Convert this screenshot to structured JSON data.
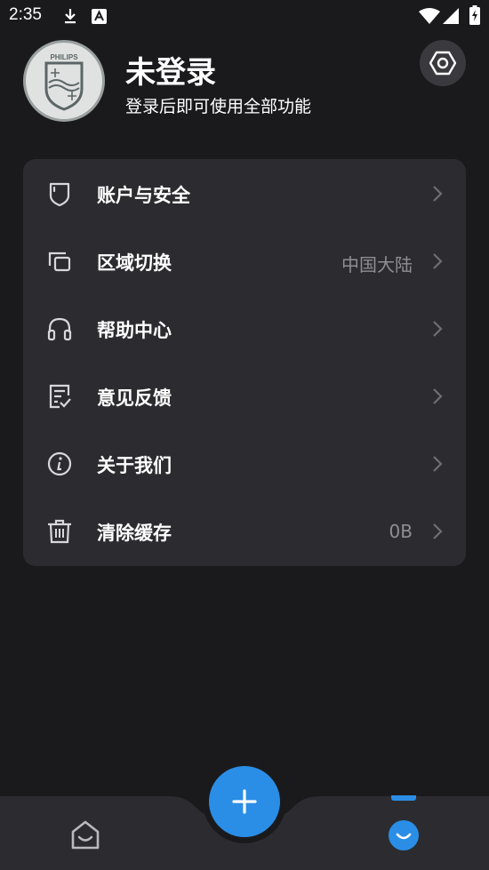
{
  "status_bar": {
    "time": "2:35",
    "icons": [
      "download-icon",
      "font-icon",
      "wifi-icon",
      "signal-icon",
      "battery-charging-icon"
    ]
  },
  "profile": {
    "title": "未登录",
    "subtitle": "登录后即可使用全部功能",
    "avatar_brand": "PHILIPS"
  },
  "menu": {
    "items": [
      {
        "label": "账户与安全",
        "value": "",
        "icon": "shield-icon"
      },
      {
        "label": "区域切换",
        "value": "中国大陆",
        "icon": "region-switch-icon"
      },
      {
        "label": "帮助中心",
        "value": "",
        "icon": "headphones-icon"
      },
      {
        "label": "意见反馈",
        "value": "",
        "icon": "feedback-icon"
      },
      {
        "label": "关于我们",
        "value": "",
        "icon": "info-icon"
      },
      {
        "label": "清除缓存",
        "value": "0B",
        "icon": "trash-icon"
      }
    ]
  },
  "colors": {
    "background": "#1a1a1d",
    "card": "#2c2c30",
    "accent": "#2a8ee6",
    "secondary_text": "#8e8e93"
  },
  "bottom_nav": {
    "tabs": [
      "home-tab",
      "mine-tab"
    ],
    "active": "mine-tab",
    "fab_icon": "plus-icon"
  }
}
